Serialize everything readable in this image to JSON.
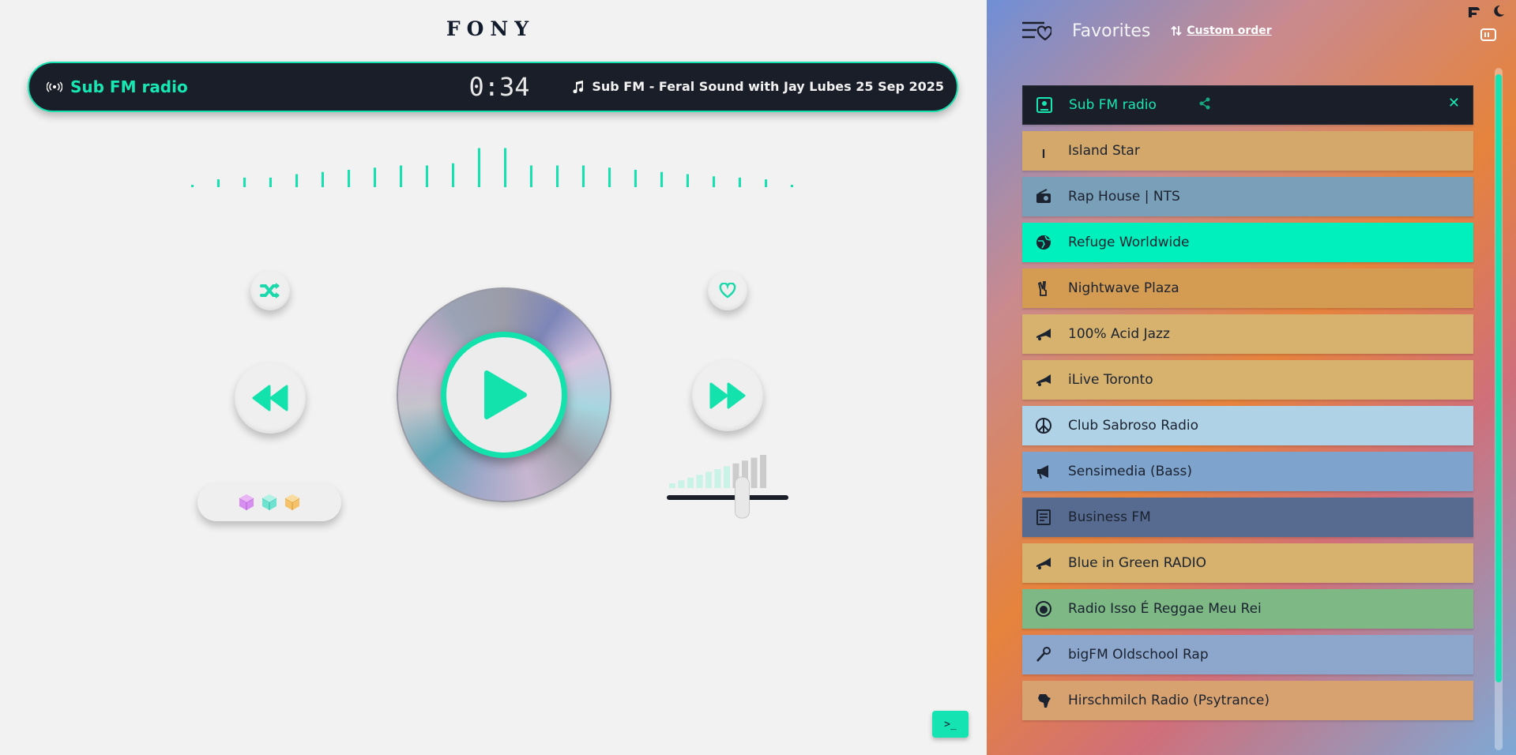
{
  "player": {
    "logo": "FONY",
    "station_name": "Sub FM radio",
    "elapsed": "0:34",
    "track_title": "Sub FM - Feral Sound with Jay Lubes 25 Sep 2025",
    "visualizer_levels": [
      0.05,
      0.18,
      0.22,
      0.22,
      0.3,
      0.35,
      0.4,
      0.45,
      0.5,
      0.5,
      0.55,
      0.9,
      0.9,
      0.5,
      0.5,
      0.5,
      0.45,
      0.4,
      0.35,
      0.3,
      0.25,
      0.22,
      0.18,
      0.05
    ],
    "volume_level": 0.62,
    "accent_color": "#14e3b0",
    "console_label": ">_",
    "icons": {
      "shuffle": "shuffle-icon",
      "heart": "heart-icon",
      "rewind": "rewind-icon",
      "forward": "fast-forward-icon",
      "play": "play-icon"
    }
  },
  "favorites": {
    "title": "Favorites",
    "sort_label": "Custom order",
    "items": [
      {
        "name": "Sub FM radio",
        "icon": "station-icon",
        "color": "#1a1e29",
        "active": true
      },
      {
        "name": "Island Star",
        "icon": "palm-tree-icon",
        "color": "#d3a86a"
      },
      {
        "name": "Rap House | NTS",
        "icon": "radio-icon",
        "color": "#7a9fb8"
      },
      {
        "name": "Refuge Worldwide",
        "icon": "globe-icon",
        "color": "#00f0bd"
      },
      {
        "name": "Nightwave Plaza",
        "icon": "peace-hand-icon",
        "color": "#d49b52"
      },
      {
        "name": "100% Acid Jazz",
        "icon": "trumpet-icon",
        "color": "#d6b26e"
      },
      {
        "name": "iLive Toronto",
        "icon": "trumpet-icon",
        "color": "#d6b26e"
      },
      {
        "name": "Club Sabroso Radio",
        "icon": "peace-icon",
        "color": "#b0d2e6"
      },
      {
        "name": "Sensimedia (Bass)",
        "icon": "megaphone-icon",
        "color": "#7ea3cc"
      },
      {
        "name": "Business FM",
        "icon": "newspaper-icon",
        "color": "#566b8f"
      },
      {
        "name": "Blue in Green RADIO",
        "icon": "trumpet-icon",
        "color": "#d6b26e"
      },
      {
        "name": "Radio Isso É Reggae Meu Rei",
        "icon": "lion-icon",
        "color": "#7db885"
      },
      {
        "name": "bigFM Oldschool Rap",
        "icon": "microphone-icon",
        "color": "#8ca6cc"
      },
      {
        "name": "Hirschmilch Radio (Psytrance)",
        "icon": "africa-icon",
        "color": "#d7a26f"
      }
    ]
  }
}
